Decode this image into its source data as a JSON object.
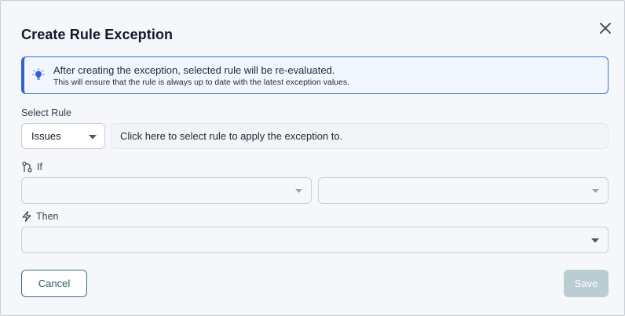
{
  "dialog": {
    "title": "Create Rule Exception",
    "close_icon": "close-icon"
  },
  "info_banner": {
    "icon": "lightbulb-icon",
    "message": "After creating the exception, selected rule will be re-evaluated.",
    "detail": "This will ensure that the rule is always up to date with the latest exception values.",
    "accent_color": "#2f62d8"
  },
  "select_rule": {
    "label": "Select Rule",
    "type_value": "Issues",
    "rule_placeholder": "Click here to select rule to apply the exception to."
  },
  "if_section": {
    "label": "If",
    "icon": "branch-condition-icon",
    "left_value": "",
    "right_value": ""
  },
  "then_section": {
    "label": "Then",
    "icon": "lightning-icon",
    "value": ""
  },
  "actions": {
    "cancel_label": "Cancel",
    "save_label": "Save",
    "cancel_color": "#2d5b68",
    "save_disabled_color": "#b9cdd2"
  }
}
